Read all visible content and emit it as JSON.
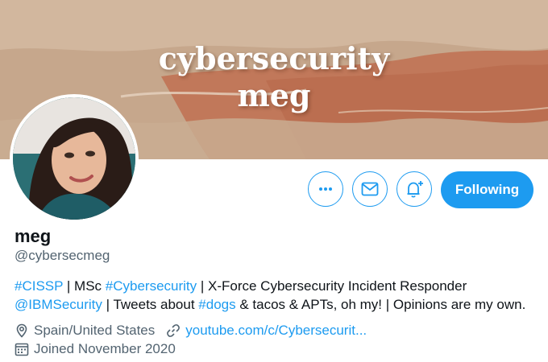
{
  "banner": {
    "title_line1": "cybersecurity",
    "title_line2": "meg"
  },
  "actions": {
    "more_icon": "more-icon",
    "message_icon": "envelope-icon",
    "notify_icon": "bell-plus-icon",
    "follow_label": "Following"
  },
  "profile": {
    "name": "meg",
    "handle": "@cybersecmeg",
    "bio": {
      "tag_cissp": "#CISSP",
      "sep1": " | MSc ",
      "tag_cyber": "#Cybersecurity",
      "sep2": " | X-Force Cybersecurity Incident Responder",
      "mention_ibm": "@IBMSecurity",
      "sep3": " | Tweets about ",
      "tag_dogs": "#dogs",
      "sep4": " & tacos & APTs, oh my! | Opinions are my own."
    },
    "location": "Spain/United States",
    "website": "youtube.com/c/Cybersecurit...",
    "joined": "Joined November 2020"
  },
  "colors": {
    "accent": "#1d9bf0",
    "muted": "#536471",
    "text": "#0f1419"
  }
}
